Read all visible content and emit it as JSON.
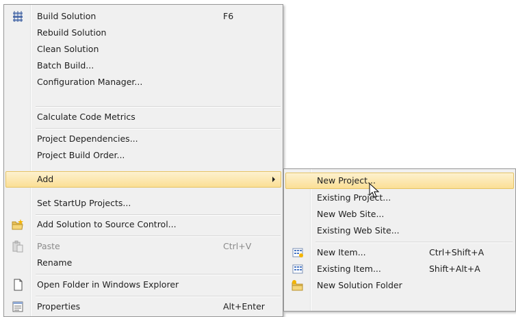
{
  "main_menu": {
    "items": [
      {
        "label": "Build Solution",
        "shortcut": "F6",
        "icon": "build-solution-icon"
      },
      {
        "label": "Rebuild Solution"
      },
      {
        "label": "Clean Solution"
      },
      {
        "label": "Batch Build..."
      },
      {
        "label": "Configuration Manager..."
      },
      {
        "label": "Calculate Code Metrics"
      },
      {
        "label": "Project Dependencies..."
      },
      {
        "label": "Project Build Order..."
      },
      {
        "label": "Add",
        "submenu": true
      },
      {
        "label": "Set StartUp Projects..."
      },
      {
        "label": "Add Solution to Source Control...",
        "icon": "source-control-folder-icon"
      },
      {
        "label": "Paste",
        "shortcut": "Ctrl+V",
        "disabled": true,
        "icon": "paste-icon"
      },
      {
        "label": "Rename"
      },
      {
        "label": "Open Folder in Windows Explorer",
        "icon": "open-folder-icon"
      },
      {
        "label": "Properties",
        "shortcut": "Alt+Enter",
        "icon": "properties-icon"
      }
    ]
  },
  "add_submenu": {
    "items": [
      {
        "label": "New Project..."
      },
      {
        "label": "Existing Project..."
      },
      {
        "label": "New Web Site..."
      },
      {
        "label": "Existing Web Site..."
      },
      {
        "label": "New Item...",
        "shortcut": "Ctrl+Shift+A",
        "icon": "new-item-icon"
      },
      {
        "label": "Existing Item...",
        "shortcut": "Shift+Alt+A",
        "icon": "existing-item-icon"
      },
      {
        "label": "New Solution Folder",
        "icon": "solution-folder-icon"
      }
    ]
  },
  "colors": {
    "menu_background": "#f0f0f0",
    "highlight_top": "#fdf1cf",
    "highlight_bottom": "#fbdf95",
    "highlight_border": "#e5c365",
    "disabled_text": "#8a8a8a"
  }
}
